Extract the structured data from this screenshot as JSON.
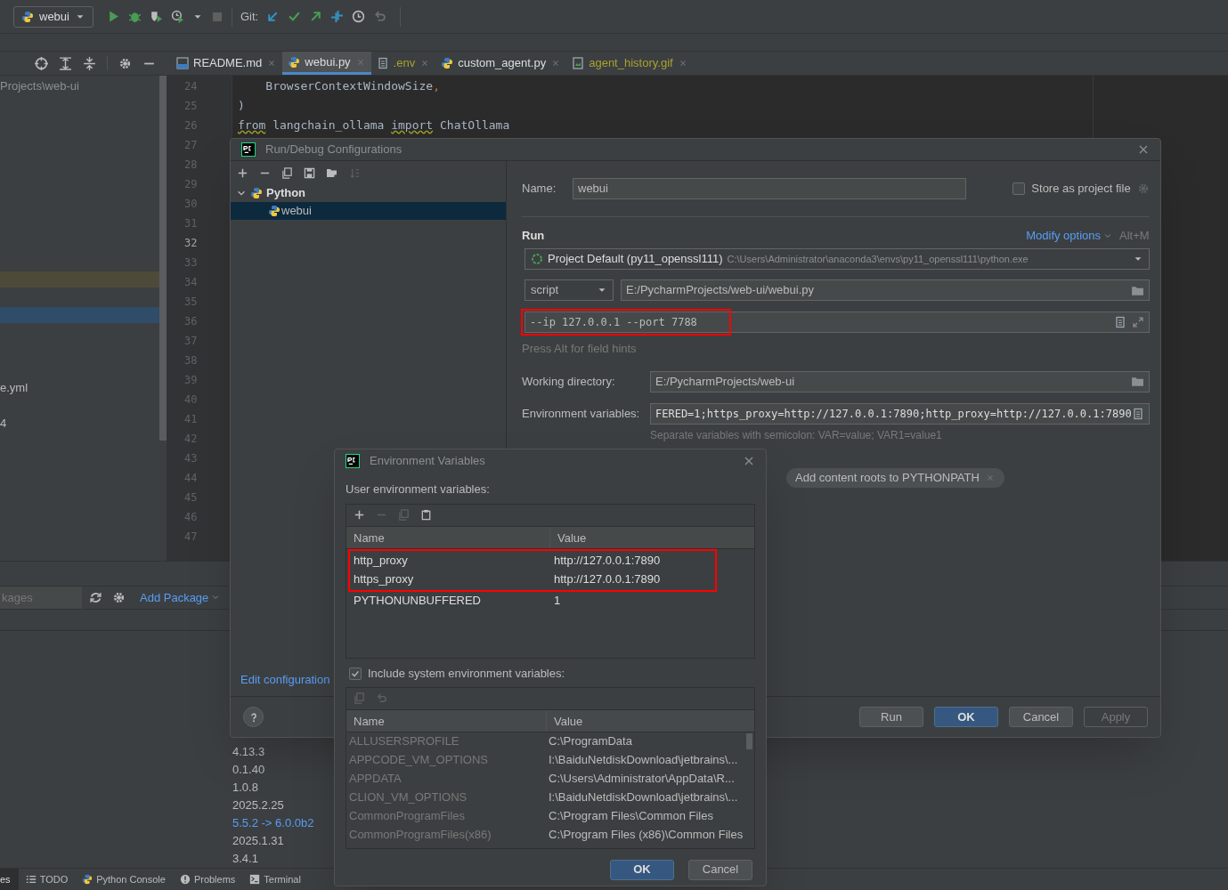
{
  "toolbar": {
    "run_config": "webui",
    "git_label": "Git:"
  },
  "editor_tabs": [
    {
      "label": "README.md",
      "kind": "markdown",
      "selected": false,
      "ignored": false
    },
    {
      "label": "webui.py",
      "kind": "python",
      "selected": true,
      "ignored": false
    },
    {
      "label": ".env",
      "kind": "text",
      "selected": false,
      "ignored": true
    },
    {
      "label": "custom_agent.py",
      "kind": "python",
      "selected": false,
      "ignored": false
    },
    {
      "label": "agent_history.gif",
      "kind": "image",
      "selected": false,
      "ignored": true
    }
  ],
  "project_panel": {
    "path": "Projects\\web-ui",
    "items": [
      {
        "label": "e.yml"
      },
      {
        "label": "4"
      }
    ]
  },
  "editor": {
    "lines": [
      {
        "number": "24",
        "current": false
      },
      {
        "number": "25",
        "current": false
      },
      {
        "number": "26",
        "current": false
      },
      {
        "number": "27",
        "current": false
      },
      {
        "number": "28",
        "current": false
      },
      {
        "number": "29",
        "current": false
      },
      {
        "number": "30",
        "current": false
      },
      {
        "number": "31",
        "current": false
      },
      {
        "number": "32",
        "current": true
      },
      {
        "number": "33",
        "current": false
      },
      {
        "number": "34",
        "current": false
      },
      {
        "number": "35",
        "current": false
      },
      {
        "number": "36",
        "current": false
      },
      {
        "number": "37",
        "current": false
      },
      {
        "number": "38",
        "current": false
      },
      {
        "number": "39",
        "current": false
      },
      {
        "number": "40",
        "current": false
      },
      {
        "number": "41",
        "current": false
      },
      {
        "number": "42",
        "current": false
      },
      {
        "number": "43",
        "current": false
      },
      {
        "number": "44",
        "current": false
      },
      {
        "number": "45",
        "current": false
      },
      {
        "number": "46",
        "current": false
      },
      {
        "number": "47",
        "current": false
      }
    ],
    "code": [
      [
        {
          "text": "    BrowserContextWindowSize",
          "kind": "plain"
        },
        {
          "text": ",",
          "kind": "punct"
        }
      ],
      [
        {
          "text": ")",
          "kind": "plain"
        }
      ],
      [
        {
          "text": "from",
          "kind": "keyword"
        },
        {
          "text": " langchain_ollama ",
          "kind": "plain"
        },
        {
          "text": "import",
          "kind": "keyword"
        },
        {
          "text": " ChatOllama",
          "kind": "plain"
        }
      ]
    ]
  },
  "packages_panel": {
    "search_placeholder": "kages",
    "add_package": "Add Package",
    "versions": [
      {
        "text": "4.13.3",
        "upgrade": false
      },
      {
        "text": "0.1.40",
        "upgrade": false
      },
      {
        "text": "1.0.8",
        "upgrade": false
      },
      {
        "text": "2025.2.25",
        "upgrade": false
      },
      {
        "text": "5.5.2 -> 6.0.0b2",
        "upgrade": true
      },
      {
        "text": "2025.1.31",
        "upgrade": false
      },
      {
        "text": "3.4.1",
        "upgrade": false
      }
    ]
  },
  "bottom_tabs": [
    {
      "label": "es",
      "kind": "none",
      "selected": true
    },
    {
      "label": "TODO",
      "kind": "list",
      "selected": false
    },
    {
      "label": "Python Console",
      "kind": "python",
      "selected": false
    },
    {
      "label": "Problems",
      "kind": "alert",
      "selected": false
    },
    {
      "label": "Terminal",
      "kind": "terminal",
      "selected": false
    }
  ],
  "run_debug_dialog": {
    "title": "Run/Debug Configurations",
    "tree": [
      {
        "label": "Python",
        "expanded": true,
        "selected": false,
        "children": [
          {
            "label": "webui",
            "selected": true
          }
        ]
      }
    ],
    "edit_link": "Edit configuration",
    "name_label": "Name:",
    "name_value": "webui",
    "store_label": "Store as project file",
    "store_checked": false,
    "section": "Run",
    "modify_options": "Modify options",
    "shortcut": "Alt+M",
    "interpreter": "Project Default (py11_openssl111)",
    "interpreter_path": "C:\\Users\\Administrator\\anaconda3\\envs\\py11_openssl111\\python.exe",
    "run_type": "script",
    "script_path": "E:/PycharmProjects/web-ui/webui.py",
    "parameters": {
      "value": "--ip 127.0.0.1 --port 7788",
      "highlighted": true
    },
    "field_hint": "Press Alt for field hints",
    "workdir_label": "Working directory:",
    "workdir": "E:/PycharmProjects/web-ui",
    "env_label": "Environment variables:",
    "env_value": "FERED=1;https_proxy=http://127.0.0.1:7890;http_proxy=http://127.0.0.1:7890",
    "env_hint": "Separate variables with semicolon: VAR=value; VAR1=value1",
    "chips": [
      {
        "label": "Add content roots to PYTHONPATH"
      }
    ],
    "buttons": [
      {
        "label": "Run",
        "primary": false,
        "disabled": false
      },
      {
        "label": "OK",
        "primary": true,
        "disabled": false
      },
      {
        "label": "Cancel",
        "primary": false,
        "disabled": false
      },
      {
        "label": "Apply",
        "primary": false,
        "disabled": true
      }
    ]
  },
  "env_dialog": {
    "title": "Environment Variables",
    "user_label": "User environment variables:",
    "columns": [
      "Name",
      "Value"
    ],
    "user_vars": [
      {
        "name": "http_proxy",
        "value": "http://127.0.0.1:7890",
        "highlighted": true
      },
      {
        "name": "https_proxy",
        "value": "http://127.0.0.1:7890",
        "highlighted": true
      },
      {
        "name": "PYTHONUNBUFFERED",
        "value": "1",
        "highlighted": false
      }
    ],
    "include_system_label": "Include system environment variables:",
    "include_system_checked": true,
    "system_columns": [
      "Name",
      "Value"
    ],
    "system_vars": [
      {
        "name": "ALLUSERSPROFILE",
        "value": "C:\\ProgramData"
      },
      {
        "name": "APPCODE_VM_OPTIONS",
        "value": "I:\\BaiduNetdiskDownload\\jetbrains\\..."
      },
      {
        "name": "APPDATA",
        "value": "C:\\Users\\Administrator\\AppData\\R..."
      },
      {
        "name": "CLION_VM_OPTIONS",
        "value": "I:\\BaiduNetdiskDownload\\jetbrains\\..."
      },
      {
        "name": "CommonProgramFiles",
        "value": "C:\\Program Files\\Common Files"
      },
      {
        "name": "CommonProgramFiles(x86)",
        "value": "C:\\Program Files (x86)\\Common Files"
      }
    ],
    "buttons": [
      {
        "label": "OK",
        "primary": true,
        "disabled": false
      },
      {
        "label": "Cancel",
        "primary": false,
        "disabled": false
      }
    ]
  }
}
